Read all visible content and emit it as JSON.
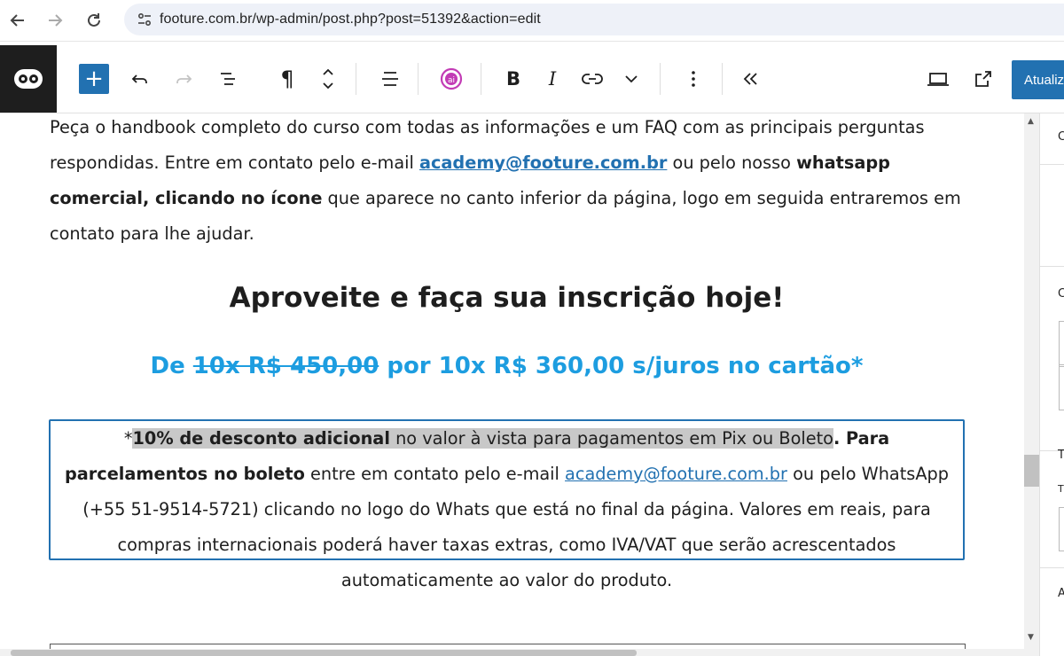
{
  "browser": {
    "url": "footure.com.br/wp-admin/post.php?post=51392&action=edit"
  },
  "toolbar": {
    "update_label": "Atualiz"
  },
  "content": {
    "para_text1": "Peça o handbook completo do curso com todas as informações e um FAQ com as principais perguntas respondidas. Entre em contato pelo e-mail ",
    "para_email": "academy@footure.com.br",
    "para_text2": " ou pelo nosso ",
    "para_bold": "whatsapp comercial, clicando no ícone",
    "para_text3": " que aparece no canto inferior da página, logo em seguida entraremos em contato para lhe ajudar.",
    "heading": "Aproveite e faça sua inscrição hoje!",
    "price_prefix": "De ",
    "price_old": "10x R$ 450,00",
    "price_new": " por 10x R$ 360,00 s/juros no cartão*",
    "notice_star": "*",
    "notice_bold1": "10% de desconto adicional",
    "notice_text1": " no valor à vista para pagamentos em Pix ou Boleto",
    "notice_bold2": ". Para parcelamentos no boleto",
    "notice_text2": " entre em contato pelo e-mail ",
    "notice_email": "academy@footure.com.br",
    "notice_text3": " ou pelo WhatsApp (+55 51-9514-5721) clicando no logo do Whats que está no final da página. Valores em reais, para compras internacionais poderá haver taxas extras, como IVA/VAT que serão acrescentados automaticamente ao valor do produto."
  },
  "sidebar": {
    "letters": [
      "C",
      "C",
      "T",
      "T",
      "A"
    ]
  },
  "colors": {
    "accent": "#2271b1",
    "price": "#1d9de0",
    "highlight": "#c8c8c8"
  }
}
